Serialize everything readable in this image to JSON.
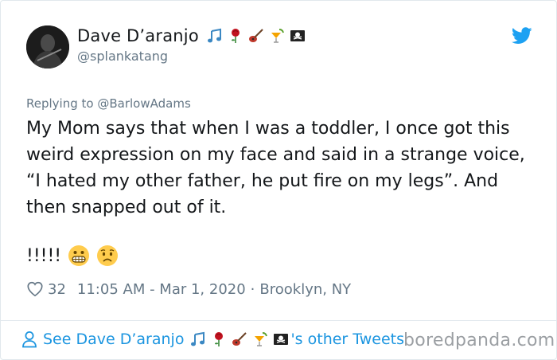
{
  "tweet": {
    "display_name": "Dave D’aranjo",
    "handle": "@splankatang",
    "name_emojis": [
      "musical-notes",
      "rose",
      "guitar",
      "tropical-drink",
      "pirate-flag"
    ],
    "replying_prefix": "Replying to",
    "replying_to": "@BarlowAdams",
    "text": "My Mom says that when I was a toddler, I once got this weird expression on my face and said in a strange voice, “I hated my other father, he put fire on my legs”. And then snapped out of it.",
    "text_tail": "!!!!!",
    "tail_emojis": [
      "grimacing-face",
      "worried-face"
    ],
    "likes": "32",
    "timestamp": "11:05 AM - Mar 1, 2020",
    "separator": "·",
    "location": "Brooklyn, NY"
  },
  "footer": {
    "prefix": "See Dave D’aranjo",
    "suffix": "'s other Tweets"
  },
  "watermark": "boredpanda.com",
  "colors": {
    "twitter_blue": "#1da1f2",
    "link_blue": "#1b95e0",
    "muted_gray": "#657786",
    "text": "#14171a"
  }
}
